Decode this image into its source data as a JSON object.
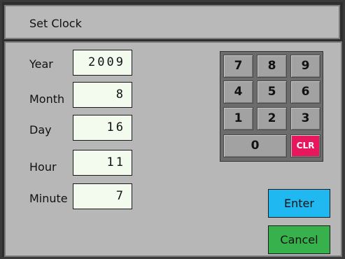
{
  "window": {
    "title": "Set Clock"
  },
  "fields": {
    "year": {
      "label": "Year",
      "value": "2009"
    },
    "month": {
      "label": "Month",
      "value": "8"
    },
    "day": {
      "label": "Day",
      "value": "16"
    },
    "hour": {
      "label": "Hour",
      "value": "11"
    },
    "minute": {
      "label": "Minute",
      "value": "7"
    }
  },
  "keypad": {
    "k7": "7",
    "k8": "8",
    "k9": "9",
    "k4": "4",
    "k5": "5",
    "k6": "6",
    "k1": "1",
    "k2": "2",
    "k3": "3",
    "k0": "0",
    "clr": "CLR"
  },
  "buttons": {
    "enter": "Enter",
    "cancel": "Cancel"
  },
  "colors": {
    "clr_key": "#e8175d",
    "enter_button": "#20b8f0",
    "cancel_button": "#37b14b",
    "field_background": "#f3fbef"
  }
}
